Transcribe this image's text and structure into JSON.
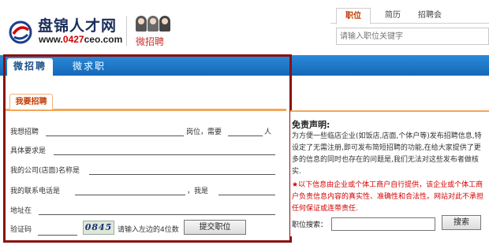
{
  "header": {
    "logo_title": "盘锦人才网",
    "logo_url_pre": "www.",
    "logo_url_mid": "0427",
    "logo_url_post": "ceo.com",
    "sub_brand": "微招聘",
    "search_tabs": [
      "职位",
      "简历",
      "招聘会"
    ],
    "search_placeholder": "请输入职位关键字"
  },
  "nav": {
    "tabs": [
      "微招聘",
      "微求职"
    ]
  },
  "form": {
    "tab_label": "我要招聘",
    "want_hire_label": "我想招聘",
    "position_label": "岗位，需要",
    "people_label": "人",
    "requirements_label": "具体要求是",
    "company_label": "我的公司(店面)名称是",
    "phone_label": "我的联系电话是",
    "i_am_label": "，我是",
    "address_label": "地址在",
    "verify_label": "验证码",
    "captcha_text": "0845",
    "captcha_hint": "请输入左边的4位数",
    "submit_label": "提交职位"
  },
  "disclaimer": {
    "title": "免责声明:",
    "body": "为方便一些临店企业(如饭店,店面,个体户等)发布招聘信息,特设定了无需注册,即可发布简短招聘的功能,在给大家提供了更多的信息的同时也存在的问题是,我们无法对这些发布者做核实.",
    "warning": "★以下信息由企业或个体工商户自行提供，该企业或个体工商户负责信息内容的真实性、准确性和合法性。网站对此不承担任何保证或连带责任.",
    "job_search_label": "职位搜索：",
    "search_button": "搜索"
  },
  "colors": {
    "nav_blue": "#1f7acb",
    "accent_orange": "#f2a65a",
    "frame_red": "#8a1010",
    "warning_red": "#d40000"
  }
}
